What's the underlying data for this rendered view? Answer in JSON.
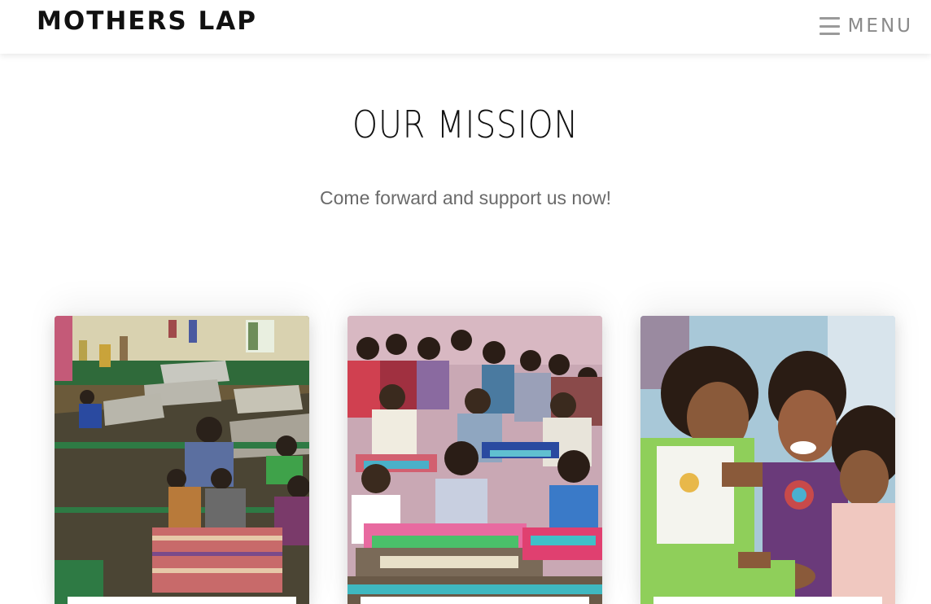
{
  "header": {
    "brand": "MOTHERS LAP",
    "menu_label": "MENU",
    "menu_icon": "hamburger-icon"
  },
  "mission": {
    "title": "OUR MISSION",
    "subtitle": "Come forward and support us now!"
  },
  "cards": [
    {
      "image": "dormitory-children-photo"
    },
    {
      "image": "children-with-books-photo"
    },
    {
      "image": "smiling-girls-photo"
    }
  ],
  "colors": {
    "background": "#ffffff",
    "brand_text": "#111111",
    "menu_gray": "#8a8a8a",
    "subtitle_gray": "#6a6a6a"
  }
}
